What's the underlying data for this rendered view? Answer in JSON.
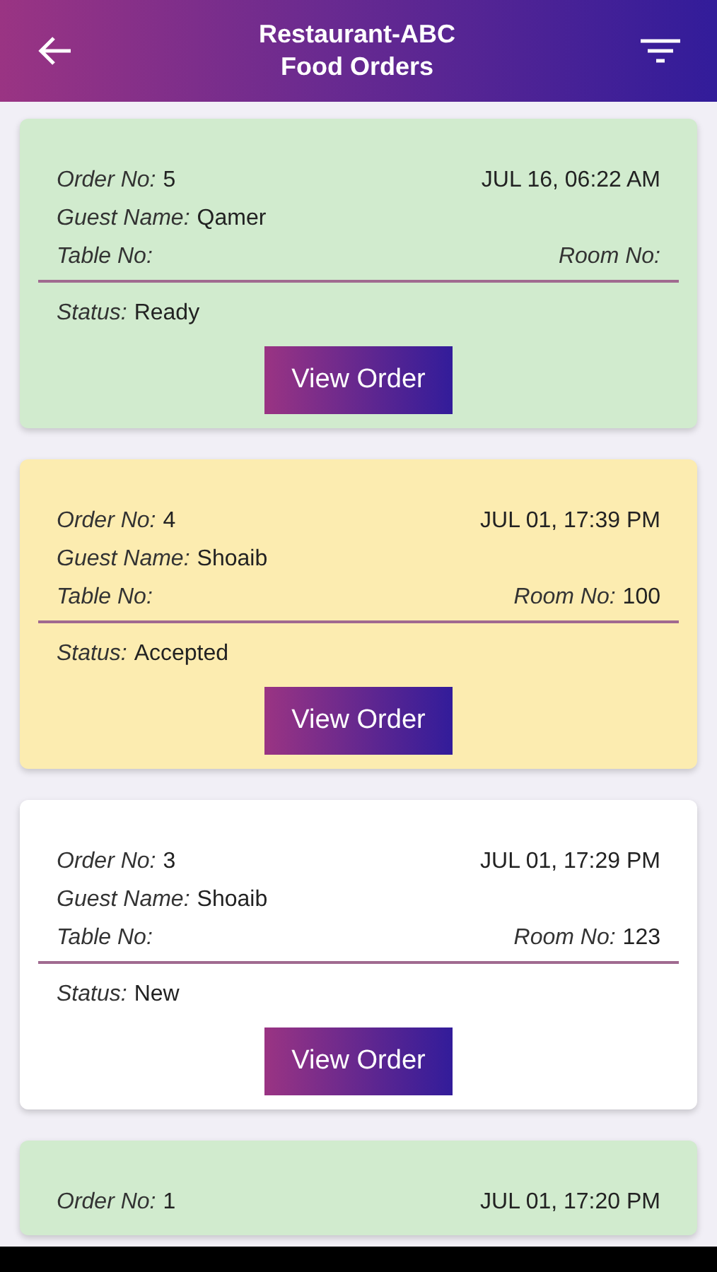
{
  "header": {
    "title_line_1": "Restaurant-ABC",
    "title_line_2": "Food Orders"
  },
  "orders": [
    {
      "color": "#d1ebce",
      "order_label": "Order No:",
      "order_no": "5",
      "datetime": "JUL 16, 06:22 AM",
      "guest_label": "Guest Name:",
      "guest_name": "Qamer",
      "table_label": "Table No:",
      "room_label": "Room No:",
      "status_label": "Status:",
      "status": "Ready",
      "button": "View Order"
    },
    {
      "color": "#fcecb0",
      "order_label": "Order No:",
      "order_no": "4",
      "datetime": "JUL 01, 17:39 PM",
      "guest_label": "Guest Name:",
      "guest_name": "Shoaib",
      "table_label": "Table No:",
      "room_label": "Room No:",
      "room_no": "100",
      "status_label": "Status:",
      "status": "Accepted",
      "button": "View Order"
    },
    {
      "color": "#ffffff",
      "order_label": "Order No:",
      "order_no": "3",
      "datetime": "JUL 01, 17:29 PM",
      "guest_label": "Guest Name:",
      "guest_name": "Shoaib",
      "table_label": "Table No:",
      "room_label": "Room No:",
      "room_no": "123",
      "status_label": "Status:",
      "status": "New",
      "button": "View Order"
    },
    {
      "color": "#d1ebce",
      "order_label": "Order No:",
      "order_no": "1",
      "datetime": "JUL 01, 17:20 PM"
    }
  ]
}
